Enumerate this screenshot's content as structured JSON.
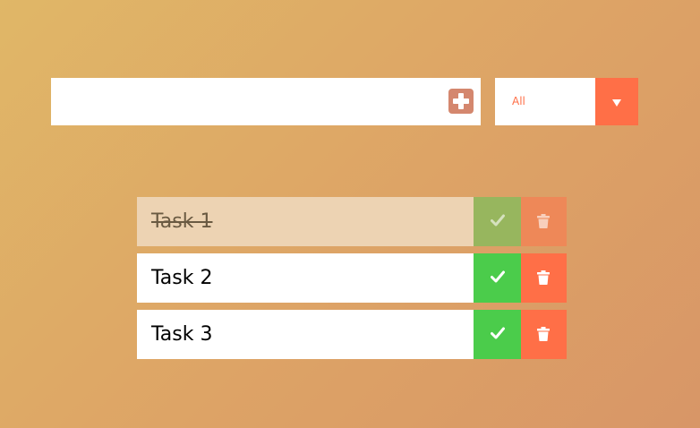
{
  "form": {
    "input_value": "",
    "input_placeholder": "",
    "add_icon": "plus-square-icon",
    "filter": {
      "selected": "All",
      "arrow_icon": "caret-down-icon"
    }
  },
  "todos": [
    {
      "text": "Task 1",
      "completed": true
    },
    {
      "text": "Task 2",
      "completed": false
    },
    {
      "text": "Task 3",
      "completed": false
    }
  ],
  "icons": {
    "complete": "check-icon",
    "delete": "trash-icon"
  },
  "colors": {
    "accent": "#FF6F47",
    "complete_green": "#4BCC4B",
    "add_button": "#D4876E",
    "completed_row": "#EDD3B3",
    "gradient_start": "#E0B767",
    "gradient_end": "#D89667"
  }
}
